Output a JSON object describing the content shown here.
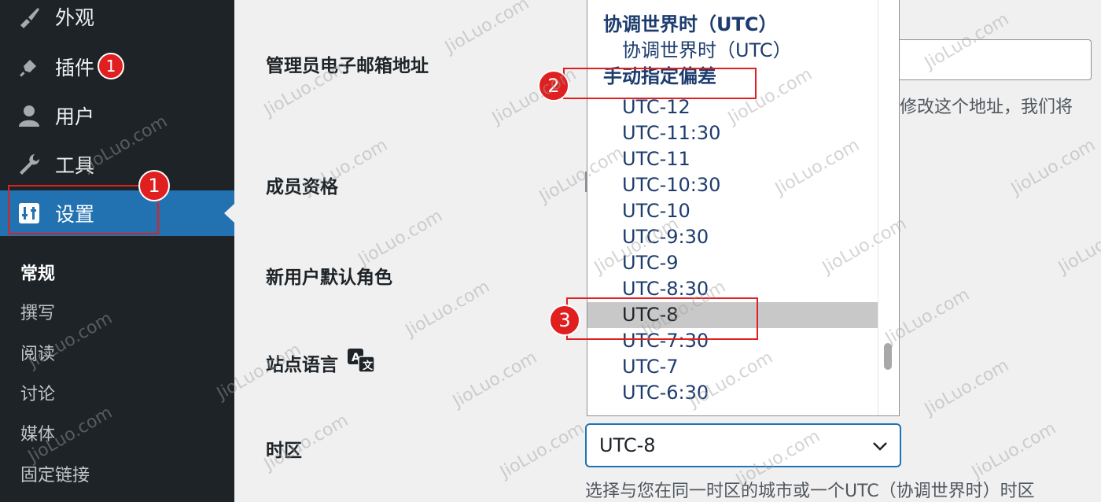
{
  "sidebar": {
    "menu": [
      {
        "label": "外观",
        "icon": "brush-icon"
      },
      {
        "label": "插件",
        "icon": "plugin-icon",
        "badge": "1"
      },
      {
        "label": "用户",
        "icon": "user-icon"
      },
      {
        "label": "工具",
        "icon": "wrench-icon"
      },
      {
        "label": "设置",
        "icon": "settings-icon",
        "active": true
      }
    ],
    "submenu": [
      {
        "label": "常规",
        "current": true
      },
      {
        "label": "撰写"
      },
      {
        "label": "阅读"
      },
      {
        "label": "讨论"
      },
      {
        "label": "媒体"
      },
      {
        "label": "固定链接"
      }
    ]
  },
  "main": {
    "labels": {
      "admin_email": "管理员电子邮箱地址",
      "membership": "成员资格",
      "default_role": "新用户默认角色",
      "site_language": "站点语言",
      "timezone": "时区"
    },
    "admin_email_desc_partial": "您修改这个地址，我们将",
    "timezone_select_value": "UTC-8",
    "timezone_desc": "选择与您在同一时区的城市或一个UTC（协调世界时）时区"
  },
  "dropdown": {
    "rows": [
      {
        "label": "协调世界时（UTC）",
        "type": "group"
      },
      {
        "label": "协调世界时（UTC）",
        "type": "option"
      },
      {
        "label": "手动指定偏差",
        "type": "group"
      },
      {
        "label": "UTC-12",
        "type": "option"
      },
      {
        "label": "UTC-11:30",
        "type": "option"
      },
      {
        "label": "UTC-11",
        "type": "option"
      },
      {
        "label": "UTC-10:30",
        "type": "option"
      },
      {
        "label": "UTC-10",
        "type": "option"
      },
      {
        "label": "UTC-9:30",
        "type": "option"
      },
      {
        "label": "UTC-9",
        "type": "option"
      },
      {
        "label": "UTC-8:30",
        "type": "option"
      },
      {
        "label": "UTC-8",
        "type": "option",
        "highlighted": true
      },
      {
        "label": "UTC-7:30",
        "type": "option"
      },
      {
        "label": "UTC-7",
        "type": "option"
      },
      {
        "label": "UTC-6:30",
        "type": "option"
      }
    ]
  },
  "annotations": {
    "step1": "1",
    "step2": "2",
    "step3": "3"
  },
  "watermark": "JioLuo.com",
  "colors": {
    "sidebar_bg": "#1d2327",
    "active_blue": "#2271b1",
    "badge_red": "#d63638",
    "annotation_red": "#e02020",
    "highlight_gray": "#c8c8c8"
  }
}
